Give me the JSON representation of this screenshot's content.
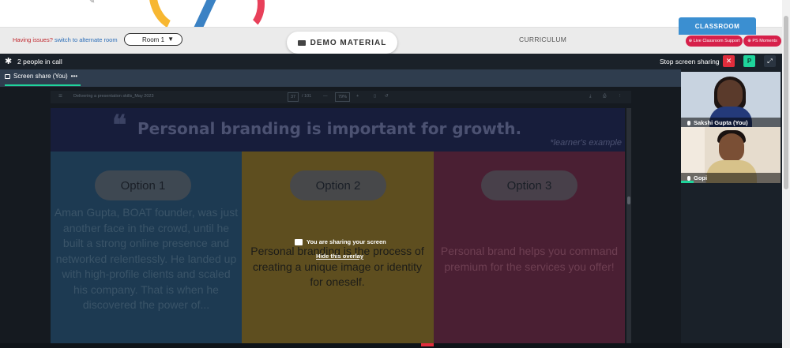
{
  "header": {
    "issues_text": "Having issues?",
    "alt_room_link": "switch to alternate room",
    "room_select_value": "Room 1",
    "demo_material_label": "DEMO MATERIAL",
    "curriculum_label": "CURRICULUM",
    "classroom_tab_label": "CLASSROOM",
    "live_support_label": "Live Classroom Support",
    "ps_moments_label": "PS Moments"
  },
  "call": {
    "people_label": "2 people in call",
    "stop_sharing_label": "Stop screen sharing",
    "close_label": "✕",
    "participant_initial": "P",
    "expand_label": "⤢"
  },
  "share": {
    "tab_label": "Screen share (You)",
    "tab_more": "•••",
    "overlay_message": "You are sharing your screen",
    "hide_overlay_link": "Hide this overlay"
  },
  "pdf": {
    "doc_title": "Delivering a presentation skills_May 2023",
    "page_current": "37",
    "page_total": "/ 101",
    "zoom": "79%",
    "zoom_out": "—",
    "zoom_in": "+"
  },
  "slide": {
    "quote_mark": "❝",
    "title": "Personal branding is important for growth.",
    "subtitle": "*learner's example",
    "columns": [
      {
        "option": "Option 1",
        "text": "Aman Gupta, BOAT founder, was just another face in the crowd, until he built a strong online presence and networked relentlessly. He landed up with high-profile clients and scaled his company. That is when he discovered the power of..."
      },
      {
        "option": "Option 2",
        "text": "Personal branding is the process of creating a unique image or identity for oneself."
      },
      {
        "option": "Option 3",
        "text": "Personal brand helps you command premium for the services you offer!"
      }
    ]
  },
  "participants": [
    {
      "name": "Sakshi Gupta (You)"
    },
    {
      "name": "Gopi"
    }
  ],
  "colors": {
    "accent_green": "#1fd49b",
    "danger_red": "#e02d3c",
    "brand_pink": "#d6204a",
    "classroom_blue": "#3b8fd1"
  }
}
